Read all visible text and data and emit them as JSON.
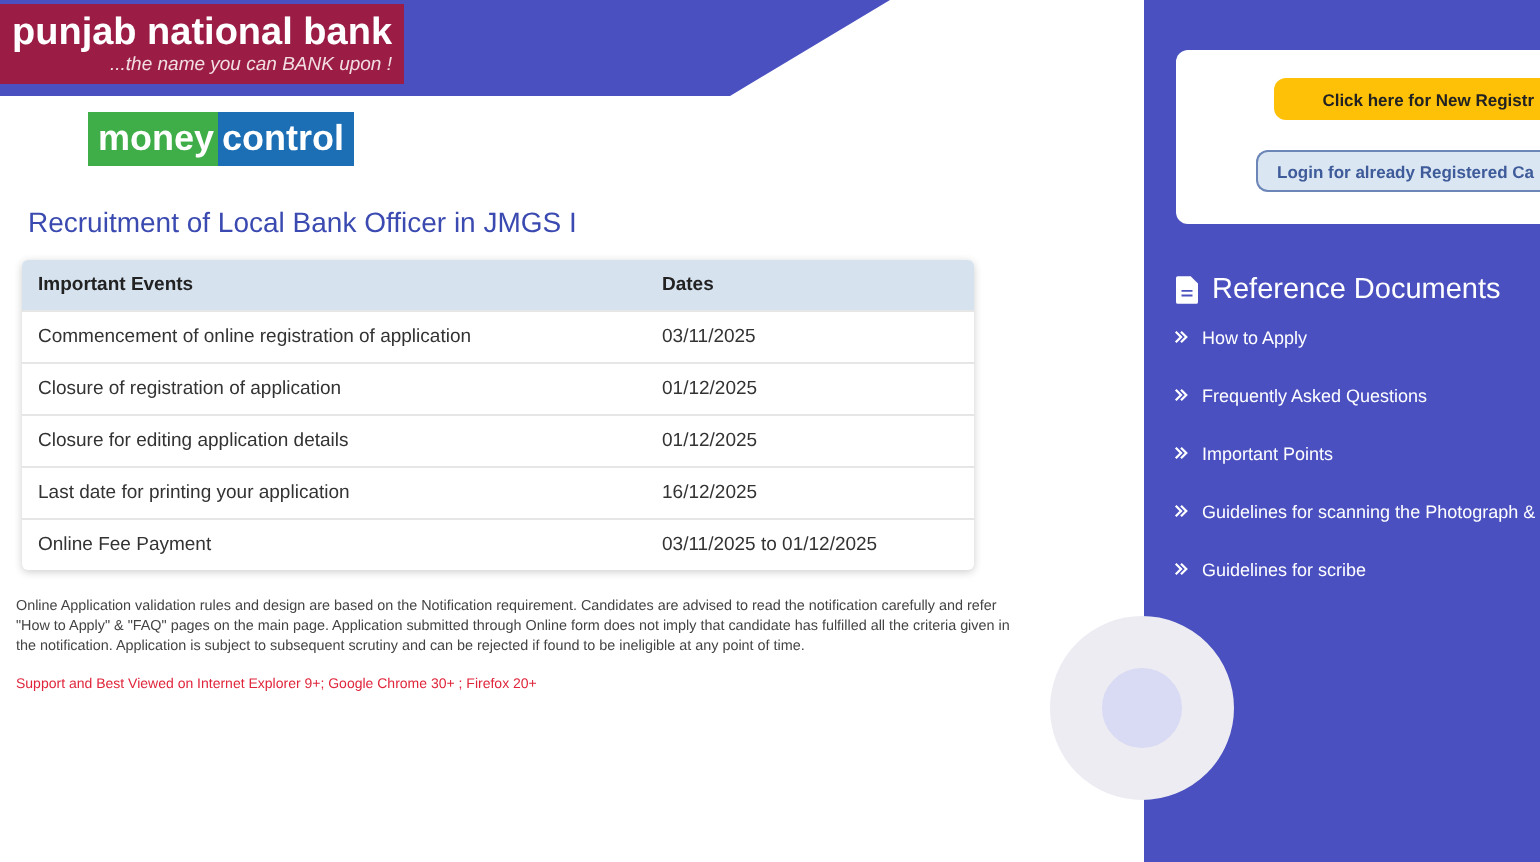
{
  "bank_logo": {
    "name": "punjab national bank",
    "tagline": "...the name you can BANK upon !"
  },
  "partner_logo": {
    "part_1": "money",
    "part_2": "control"
  },
  "title": "Recruitment of Local Bank Officer in JMGS I",
  "table": {
    "columns": [
      "Important Events",
      "Dates"
    ],
    "rows": [
      [
        "Commencement of online registration of application",
        "03/11/2025"
      ],
      [
        "Closure of registration of application",
        "01/12/2025"
      ],
      [
        "Closure for editing application details",
        "01/12/2025"
      ],
      [
        "Last date for printing your application",
        "16/12/2025"
      ],
      [
        "Online Fee Payment",
        "03/11/2025 to 01/12/2025"
      ]
    ]
  },
  "notice": "Online Application validation rules and design are based on the Notification requirement. Candidates are advised to read the notification carefully and refer \"How to Apply\" & \"FAQ\" pages on the main page. Application submitted through Online form does not imply that candidate has fulfilled all the criteria given in the notification. Application is subject to subsequent scrutiny and can be rejected if found to be ineligible at any point of time.",
  "browser_note": "Support and Best Viewed on Internet Explorer 9+; Google Chrome 30+ ; Firefox 20+",
  "sidebar": {
    "buttons": [
      {
        "kind": "primary",
        "label": "Click here for New Registr"
      },
      {
        "kind": "secondary",
        "label": "Login for already Registered Ca"
      }
    ],
    "heading": "Reference Documents",
    "links": [
      "How to Apply",
      "Frequently Asked Questions",
      "Important Points",
      "Guidelines for scanning the Photograph &",
      "Guidelines for scribe"
    ]
  }
}
